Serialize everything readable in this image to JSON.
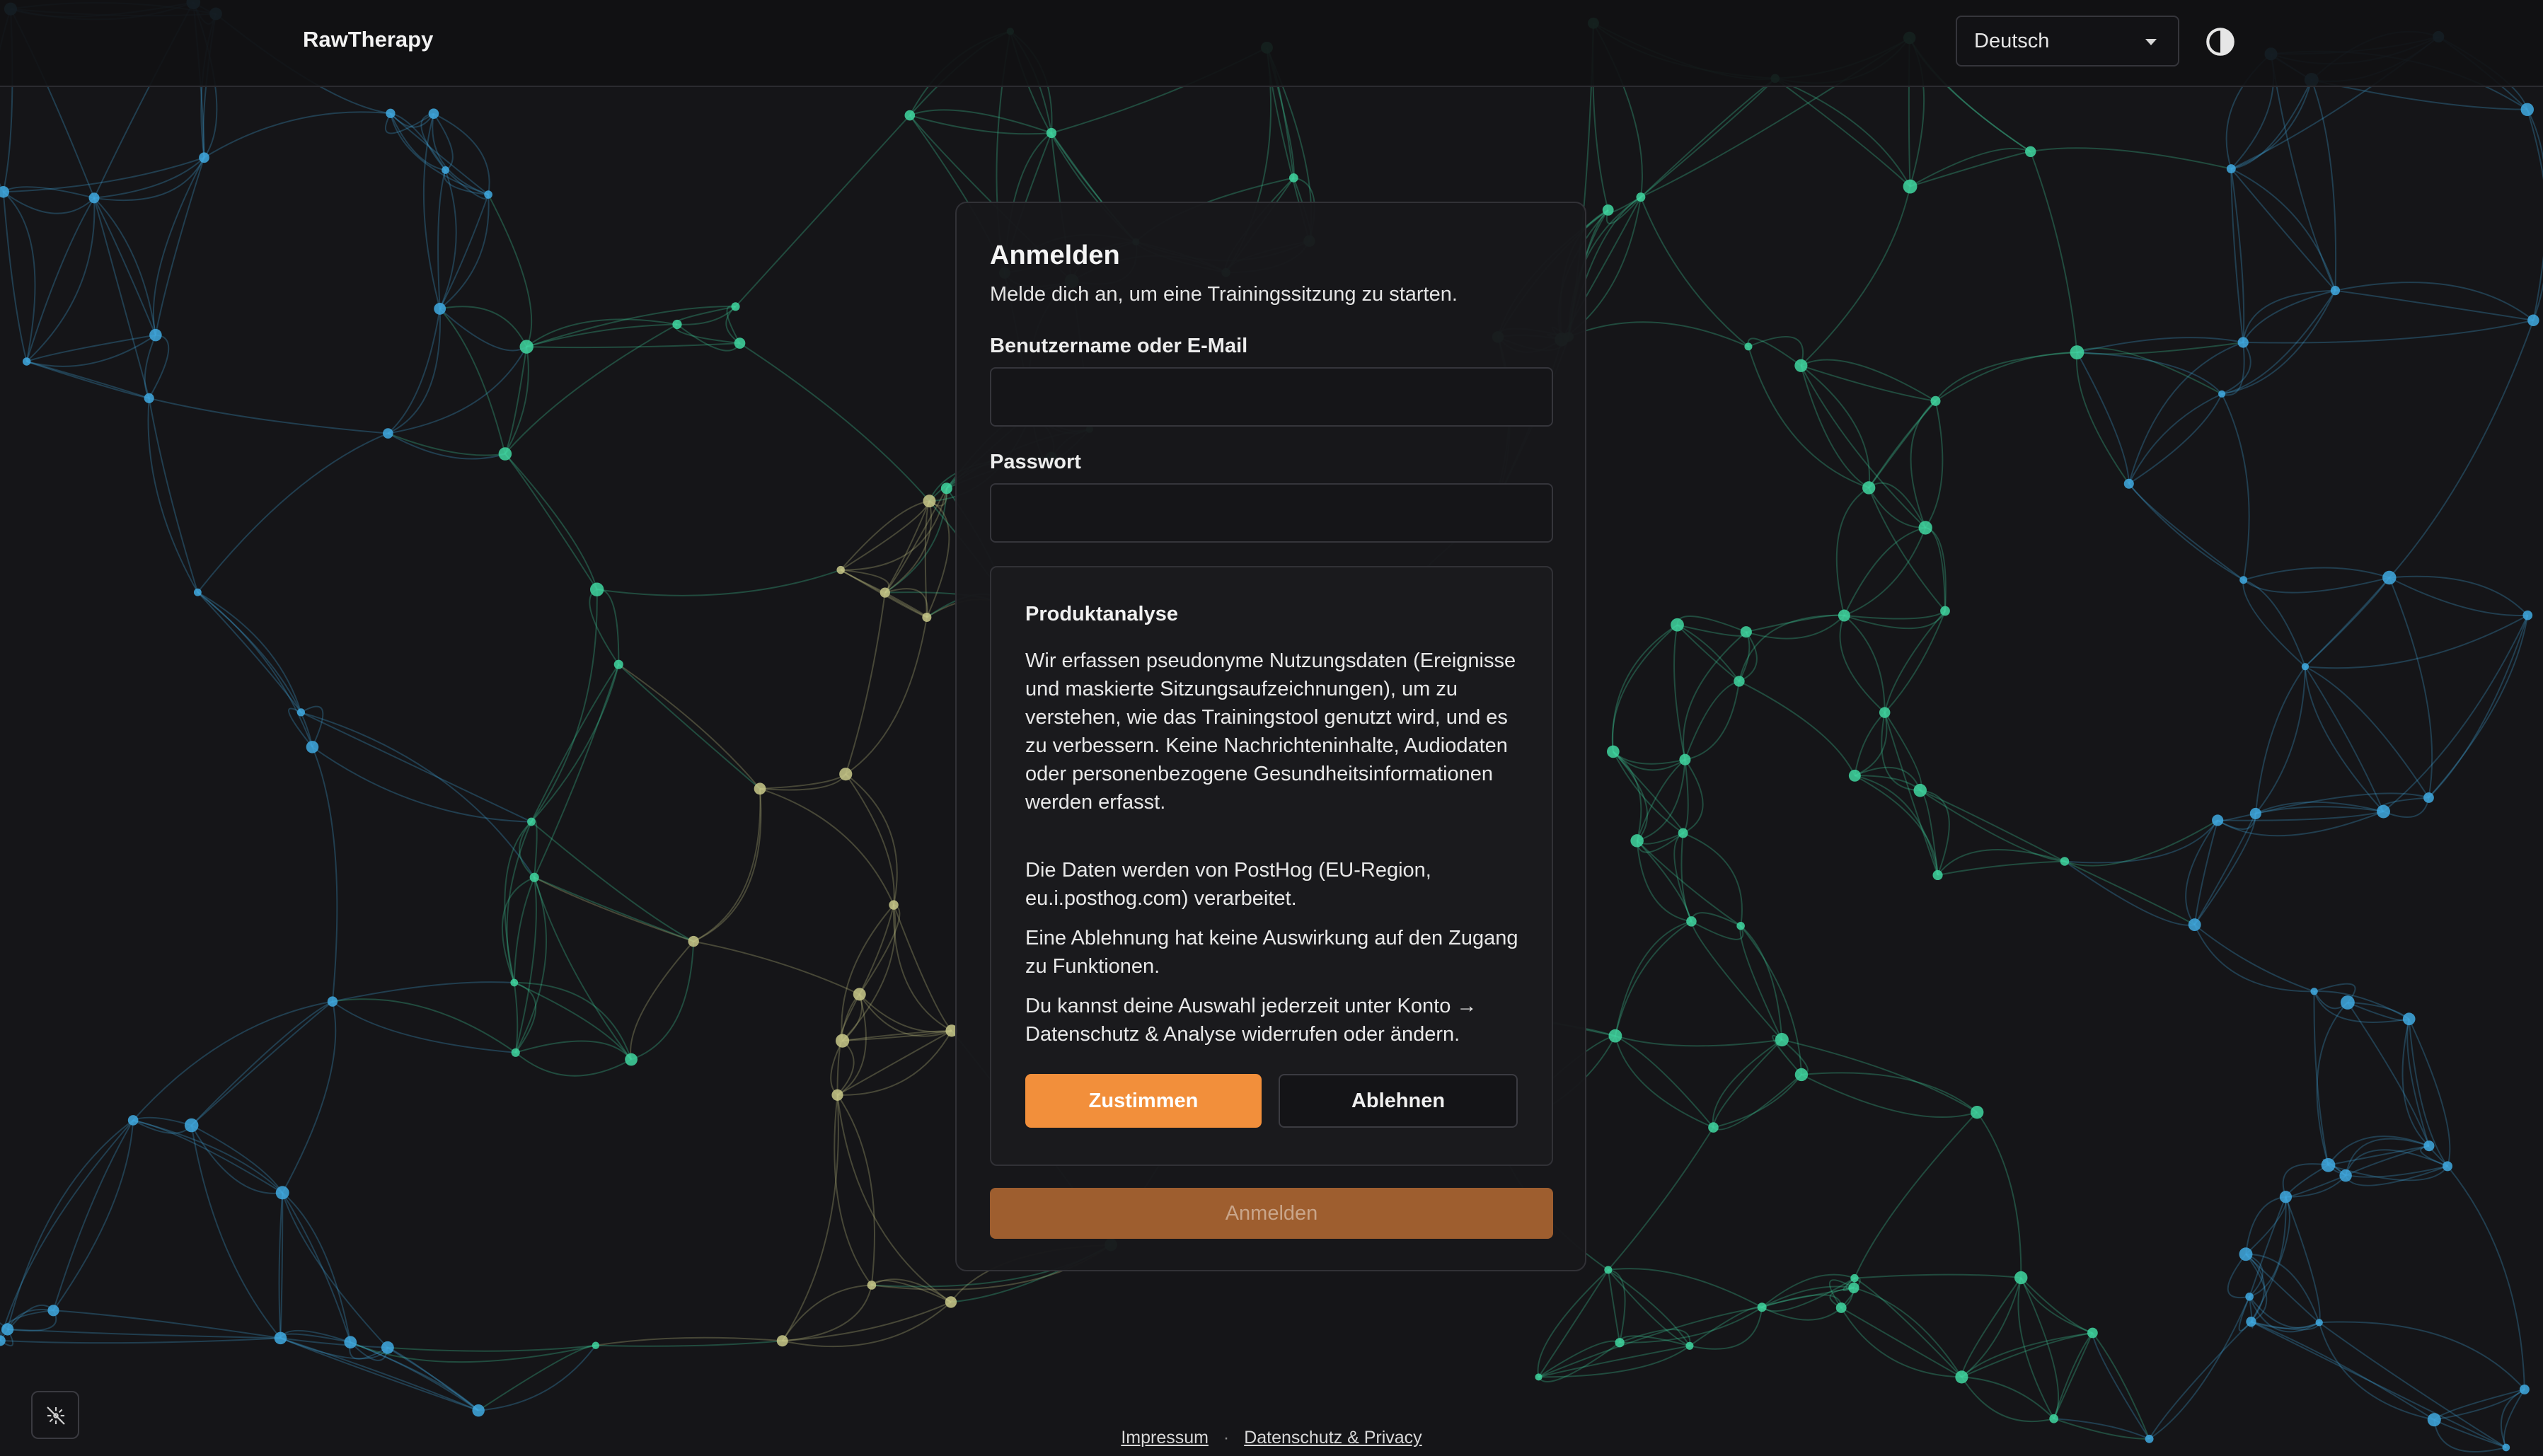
{
  "header": {
    "brand": "RawTherapy",
    "language_selected": "Deutsch",
    "theme_toggle_icon": "contrast-icon"
  },
  "login": {
    "title": "Anmelden",
    "subtitle": "Melde dich an, um eine Trainingssitzung zu starten.",
    "username_label": "Benutzername oder E-Mail",
    "username_value": "",
    "password_label": "Passwort",
    "password_value": "",
    "submit_label": "Anmelden"
  },
  "consent": {
    "title": "Produktanalyse",
    "paragraphs": [
      "Wir erfassen pseudonyme Nutzungsdaten (Ereignisse und maskierte Sitzungsaufzeichnungen), um zu verstehen, wie das Trainingstool genutzt wird, und es zu verbessern. Keine Nachrichteninhalte, Audiodaten oder personenbezogene Gesundheitsinformationen werden erfasst.",
      "Die Daten werden von PostHog (EU-Region, eu.i.posthog.com) verarbeitet.",
      "Eine Ablehnung hat keine Auswirkung auf den Zugang zu Funktionen.",
      "Du kannst deine Auswahl jederzeit unter Konto → Datenschutz & Analyse widerrufen oder ändern."
    ],
    "accept_label": "Zustimmen",
    "decline_label": "Ablehnen"
  },
  "footer": {
    "imprint": "Impressum",
    "separator": "·",
    "privacy": "Datenschutz & Privacy"
  },
  "corner_button_icon": "disable-animation-icon",
  "colors": {
    "background": "#151518",
    "accent": "#f28f3b",
    "accent_muted": "#9e5e2f",
    "network_blue": "#3fa9e0",
    "network_green": "#3fd6a0",
    "network_olive": "#c9c98a"
  }
}
